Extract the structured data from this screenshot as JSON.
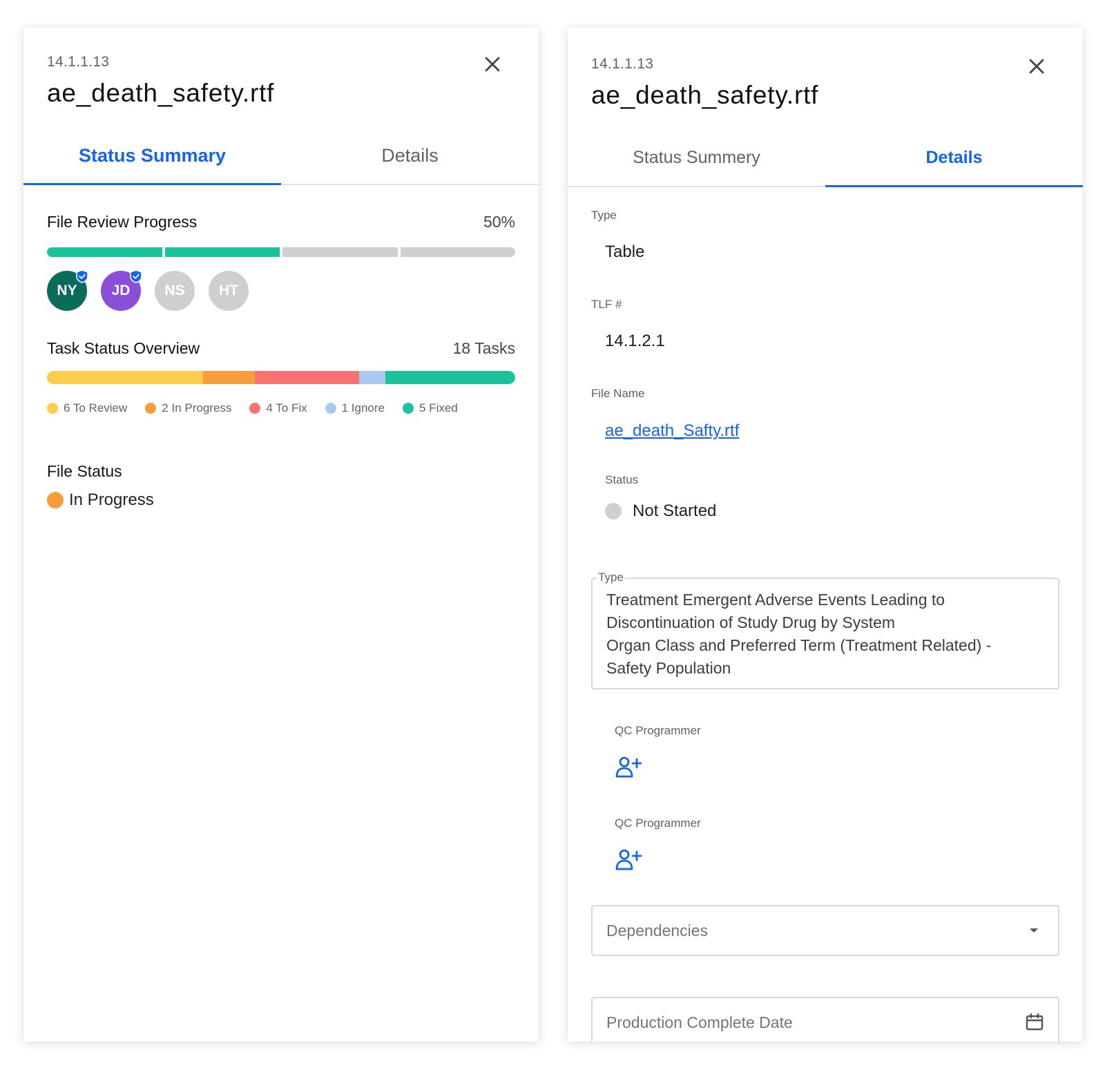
{
  "colors": {
    "accent": "#1565e8",
    "to_review": "#ffcc4d",
    "in_progress": "#f79d3a",
    "to_fix": "#f87272",
    "ignore": "#a9c8f2",
    "fixed": "#1cc39a",
    "inactive": "#cfcfcf"
  },
  "left_panel": {
    "code": "14.1.1.13",
    "title": "ae_death_safety.rtf",
    "close_icon": "close-icon",
    "tabs": [
      {
        "label": "Status Summary",
        "active": true
      },
      {
        "label": "Details",
        "active": false
      }
    ],
    "file_review": {
      "title": "File Review Progress",
      "percent_label": "50%",
      "segments_total": 4,
      "segments_done": 2
    },
    "reviewers": [
      {
        "initials": "NY",
        "color": "#0a6b5a",
        "verified": true
      },
      {
        "initials": "JD",
        "color": "#8a4fd8",
        "verified": true
      },
      {
        "initials": "NS",
        "color": "#cfcfcf",
        "verified": false
      },
      {
        "initials": "HT",
        "color": "#cfcfcf",
        "verified": false
      }
    ],
    "task_overview": {
      "title": "Task Status Overview",
      "count_label": "18 Tasks",
      "breakdown": [
        {
          "label": "6 To Review",
          "count": 6,
          "color": "#ffcc4d"
        },
        {
          "label": "2 In Progress",
          "count": 2,
          "color": "#f79d3a"
        },
        {
          "label": "4 To Fix",
          "count": 4,
          "color": "#f87272"
        },
        {
          "label": "1 Ignore",
          "count": 1,
          "color": "#a9c8f2"
        },
        {
          "label": "5 Fixed",
          "count": 5,
          "color": "#1cc39a"
        }
      ]
    },
    "file_status": {
      "title": "File Status",
      "value": "In Progress",
      "color": "#f79d3a"
    }
  },
  "right_panel": {
    "code": "14.1.1.13",
    "title": "ae_death_safety.rtf",
    "close_icon": "close-icon",
    "tabs": [
      {
        "label": "Status Summery",
        "active": false
      },
      {
        "label": "Details",
        "active": true
      }
    ],
    "type": {
      "label": "Type",
      "value": "Table"
    },
    "tlf": {
      "label": "TLF #",
      "value": "14.1.2.1"
    },
    "file_name": {
      "label": "File Name",
      "value": "ae_death_Safty.rtf"
    },
    "status": {
      "label": "Status",
      "value": "Not Started",
      "color": "#cfcfcf"
    },
    "description": {
      "label": "Type",
      "lines": [
        "Treatment Emergent Adverse Events Leading to",
        "Discontinuation of Study Drug by System",
        "Organ Class and Preferred Term (Treatment Related) -",
        "Safety Population"
      ]
    },
    "qc_programmers": [
      {
        "label": "QC Programmer",
        "icon": "add-user-icon"
      },
      {
        "label": "QC Programmer",
        "icon": "add-user-icon"
      }
    ],
    "dependencies": {
      "placeholder": "Dependencies",
      "icon": "caret-down-icon"
    },
    "production_date": {
      "placeholder": "Production Complete Date",
      "icon": "calendar-icon"
    }
  }
}
